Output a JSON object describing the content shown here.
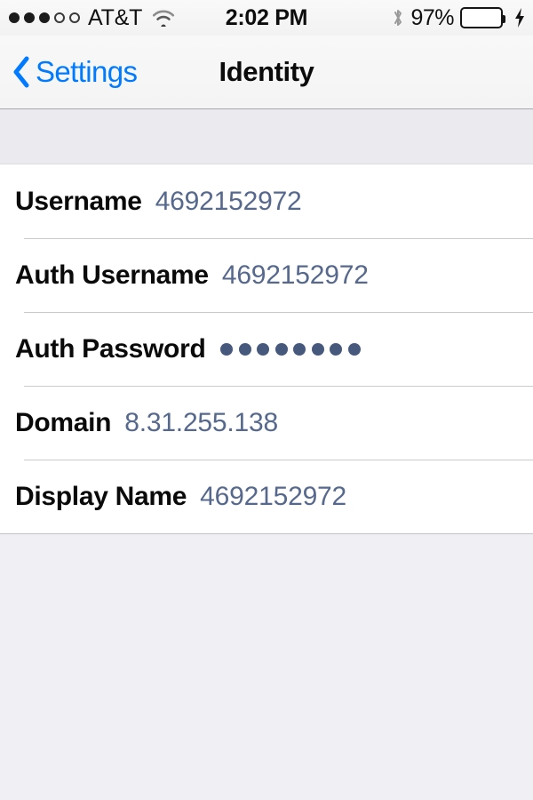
{
  "status_bar": {
    "signal_dots_filled": 3,
    "signal_dots_empty": 2,
    "carrier": "AT&T",
    "wifi_icon": "wifi-icon",
    "time": "2:02 PM",
    "bluetooth_icon": "bluetooth-icon",
    "battery_percent": "97%",
    "battery_level": 97,
    "battery_charging": true,
    "battery_color": "#4ddb5f"
  },
  "nav_bar": {
    "back_label": "Settings",
    "back_icon": "chevron-left-icon",
    "title": "Identity",
    "tint_color": "#007aff"
  },
  "form": {
    "value_color": "#56688c",
    "rows": [
      {
        "label": "Username",
        "value": "4692152972",
        "type": "text"
      },
      {
        "label": "Auth Username",
        "value": "4692152972",
        "type": "text"
      },
      {
        "label": "Auth Password",
        "value": "••••••••",
        "type": "password",
        "mask_count": 8
      },
      {
        "label": "Domain",
        "value": "8.31.255.138",
        "type": "text"
      },
      {
        "label": "Display Name",
        "value": "4692152972",
        "type": "text"
      }
    ]
  }
}
